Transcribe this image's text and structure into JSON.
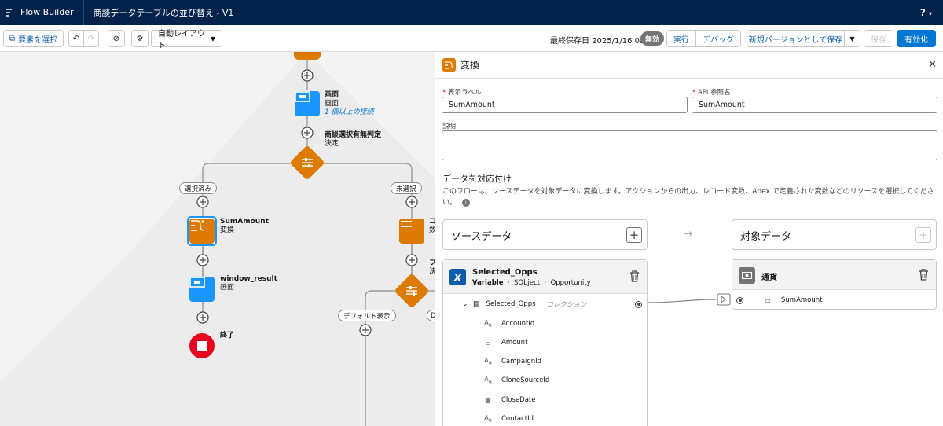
{
  "topbar": {
    "app_name": "Flow Builder",
    "flow_title": "商談データテーブルの並び替え - V1",
    "help_label": "?"
  },
  "toolbar": {
    "select_elements": "要素を選択",
    "layout_select": "自動レイアウト",
    "last_saved": "最終保存日 2025/1/16 08:55",
    "status_badge": "無効",
    "run": "実行",
    "debug": "デバッグ",
    "save_new_version": "新規バージョンとして保存",
    "save": "保存",
    "activate": "有効化"
  },
  "canvas": {
    "screen1": {
      "name": "画面",
      "type": "画面",
      "link": "1 個以上の接続"
    },
    "decision1": {
      "name": "商談選択有無判定",
      "type": "決定"
    },
    "branch_selected": "選択済み",
    "branch_unselected": "未選択",
    "transform": {
      "name": "SumAmount",
      "type": "変換"
    },
    "screen2": {
      "name": "window_result",
      "type": "画面"
    },
    "end": {
      "name": "終了"
    },
    "right_node1": {
      "name": "コ",
      "type": "数"
    },
    "right_node2": {
      "name": "フ",
      "type": "決"
    },
    "branch_default": "デフォルト表示",
    "branch_d": "D"
  },
  "panel": {
    "title": "変換",
    "label_field": {
      "label": "表示ラベル",
      "value": "SumAmount"
    },
    "api_field": {
      "label": "API 参照名",
      "value": "SumAmount"
    },
    "description_label": "説明",
    "section_title": "データを対応付け",
    "section_desc": "このフローは、ソースデータを対象データに変換します。アクションからの出力、レコード変数、Apex で定義された変数などのリソースを選択してください。",
    "source_header": "ソースデータ",
    "target_header": "対象データ",
    "source": {
      "name": "Selected_Opps",
      "meta_type": "Variable",
      "meta_object": "SObject",
      "meta_entity": "Opportunity",
      "collection_name": "Selected_Opps",
      "collection_kind": "コレクション",
      "fields": [
        {
          "name": "AccountId",
          "icon": "text-icon"
        },
        {
          "name": "Amount",
          "icon": "currency-icon"
        },
        {
          "name": "CampaignId",
          "icon": "text-icon"
        },
        {
          "name": "CloneSourceId",
          "icon": "text-icon"
        },
        {
          "name": "CloseDate",
          "icon": "date-icon"
        },
        {
          "name": "ContactId",
          "icon": "text-icon"
        }
      ]
    },
    "target": {
      "type_name": "通貨",
      "field_name": "SumAmount"
    }
  },
  "colors": {
    "navy": "#03234d",
    "brand": "#0176d3",
    "orange": "#dd7a01",
    "screen_blue": "#1b96ff",
    "end_red": "#ea001e"
  }
}
